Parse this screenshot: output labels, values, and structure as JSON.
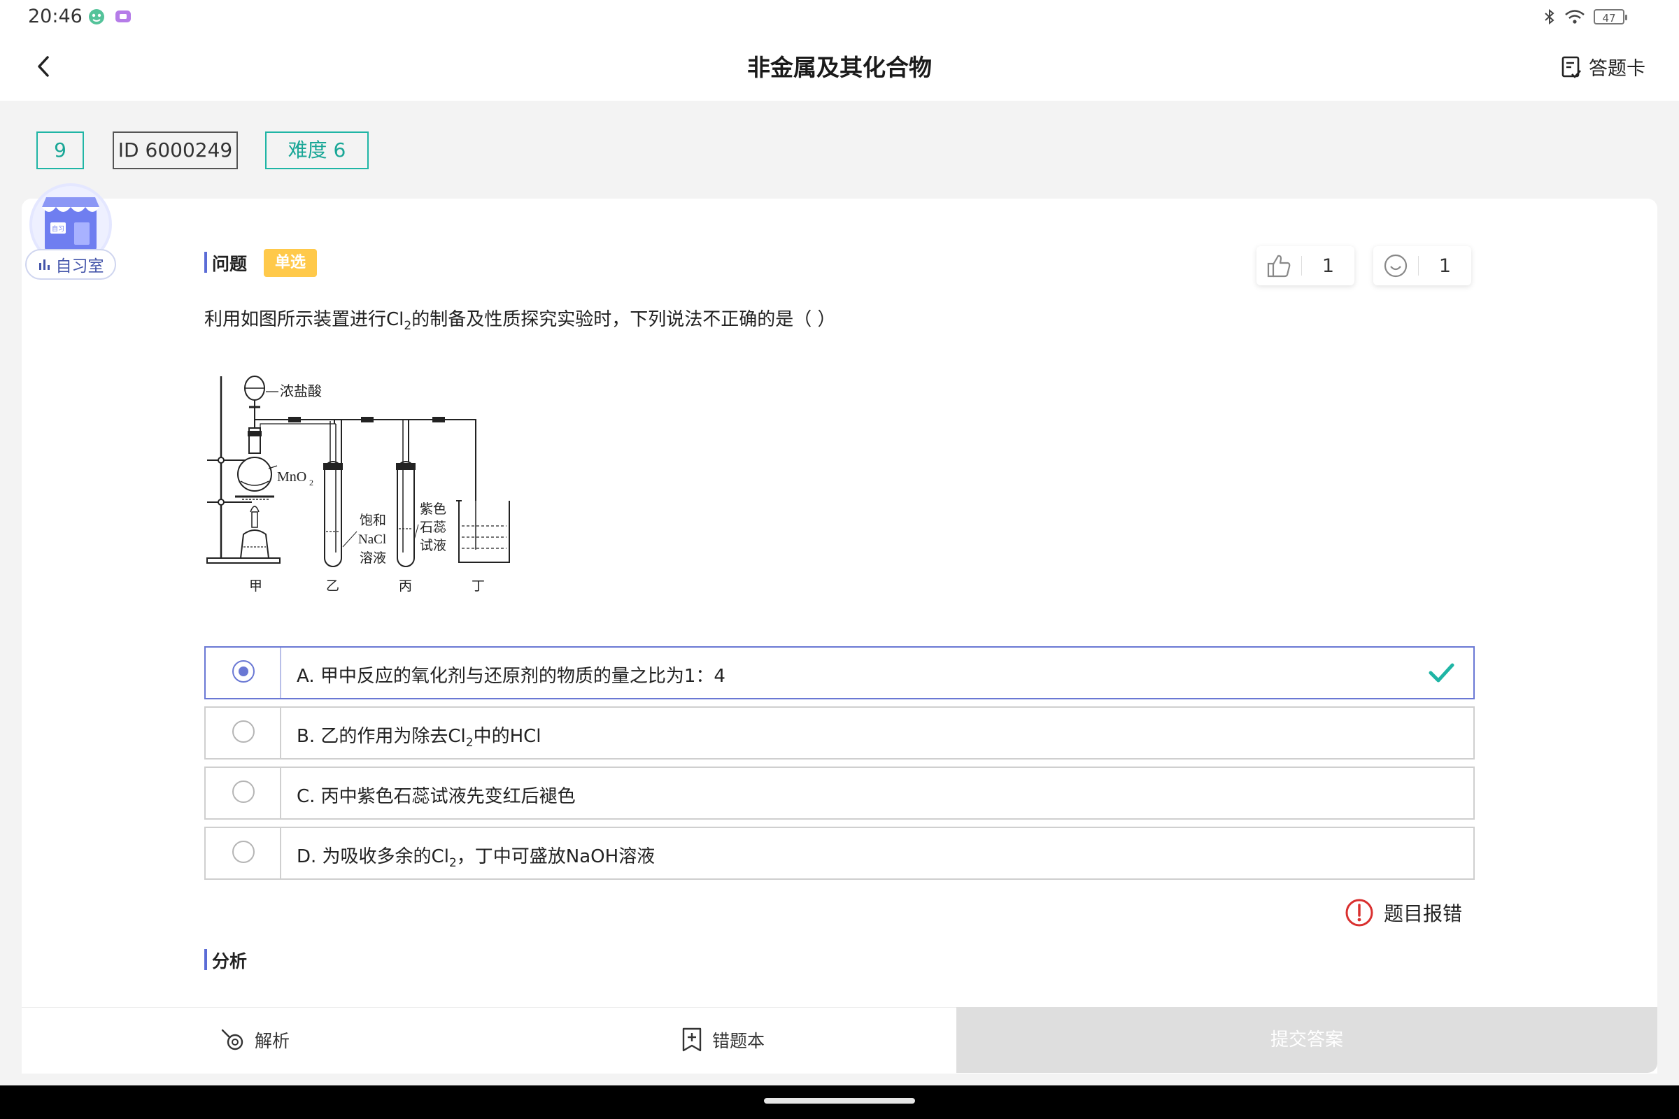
{
  "status_bar": {
    "time": "20:46",
    "battery": "47"
  },
  "header": {
    "title": "非金属及其化合物",
    "answer_card_label": "答题卡"
  },
  "tags": {
    "number": "9",
    "id": "ID 6000249",
    "difficulty": "难度 6"
  },
  "study_room": {
    "label": "自习室",
    "icon_text": "自习"
  },
  "question": {
    "section_label": "问题",
    "type_badge": "单选",
    "like_count": "1",
    "smile_count": "1",
    "text_before": "利用如图所示装置进行Cl",
    "text_sub": "2",
    "text_after": "的制备及性质探究实验时，下列说法不正确的是（    ）"
  },
  "diagram_labels": {
    "acid": "浓盐酸",
    "mno2": "MnO",
    "mno2_sub": "2",
    "nacl_1": "饱和",
    "nacl_2": "NaCl",
    "nacl_3": "溶液",
    "litmus_1": "紫色",
    "litmus_2": "石蕊",
    "litmus_3": "试液",
    "jia": "甲",
    "yi": "乙",
    "bing": "丙",
    "ding": "丁"
  },
  "options": [
    {
      "before": "A. 甲中反应的氧化剂与还原剂的物质的量之比为1：4",
      "sub": "",
      "after": "",
      "selected": true,
      "correct": true
    },
    {
      "before": "B. 乙的作用为除去Cl",
      "sub": "2",
      "after": "中的HCl",
      "selected": false,
      "correct": false
    },
    {
      "before": "C. 丙中紫色石蕊试液先变红后褪色",
      "sub": "",
      "after": "",
      "selected": false,
      "correct": false
    },
    {
      "before": "D. 为吸收多余的Cl",
      "sub": "2",
      "after": "，丁中可盛放NaOH溶液",
      "selected": false,
      "correct": false
    }
  ],
  "report_label": "题目报错",
  "analysis_label": "分析",
  "bottom_bar": {
    "analysis_button": "解析",
    "wrongbook_button": "错题本",
    "submit_button": "提交答案"
  },
  "colors": {
    "accent_teal": "#1fb5a5",
    "accent_indigo": "#5b6cd6",
    "badge_yellow": "#ffc94a",
    "correct_green": "#1fb5a5",
    "report_red": "#d9302f"
  }
}
